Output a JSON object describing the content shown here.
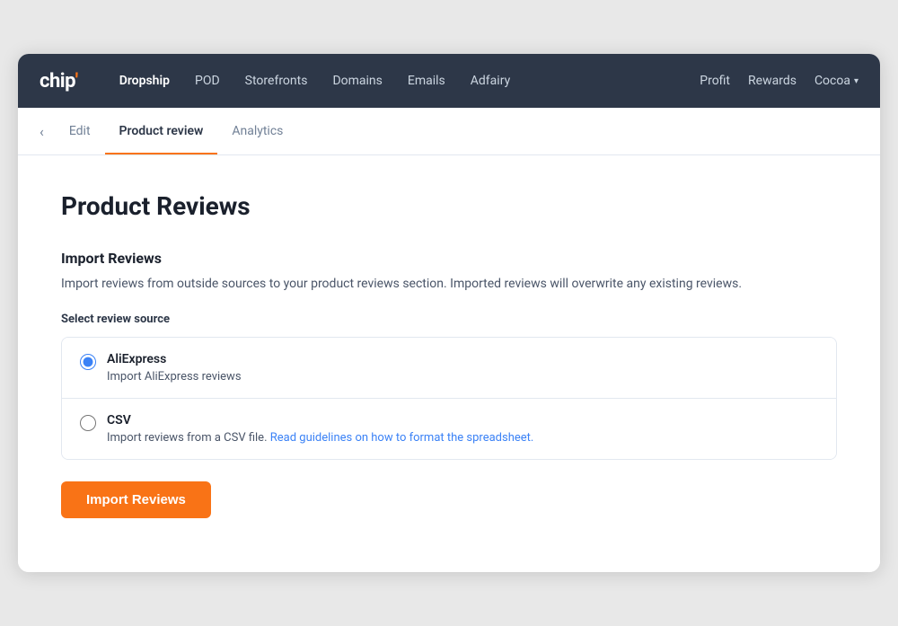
{
  "navbar": {
    "logo": "chip'",
    "links": [
      {
        "label": "Dropship",
        "active": true
      },
      {
        "label": "POD",
        "active": false
      },
      {
        "label": "Storefronts",
        "active": false
      },
      {
        "label": "Domains",
        "active": false
      },
      {
        "label": "Emails",
        "active": false
      },
      {
        "label": "Adfairy",
        "active": false
      }
    ],
    "right_links": [
      {
        "label": "Profit",
        "has_chevron": false
      },
      {
        "label": "Rewards",
        "has_chevron": false
      },
      {
        "label": "Cocoa",
        "has_chevron": true
      }
    ]
  },
  "subnav": {
    "tabs": [
      {
        "label": "Edit",
        "active": false
      },
      {
        "label": "Product review",
        "active": true
      },
      {
        "label": "Analytics",
        "active": false
      }
    ]
  },
  "main": {
    "page_title": "Product Reviews",
    "section_title": "Import Reviews",
    "section_desc": "Import reviews from outside sources to your product reviews section. Imported reviews will overwrite any existing reviews.",
    "source_label": "Select review source",
    "options": [
      {
        "id": "aliexpress",
        "label": "AliExpress",
        "desc": "Import AliExpress reviews",
        "link_text": "",
        "checked": true
      },
      {
        "id": "csv",
        "label": "CSV",
        "desc": "Import reviews from a CSV file. ",
        "link_text": "Read guidelines on how to format the spreadsheet.",
        "checked": false
      }
    ],
    "import_button": "Import Reviews"
  }
}
